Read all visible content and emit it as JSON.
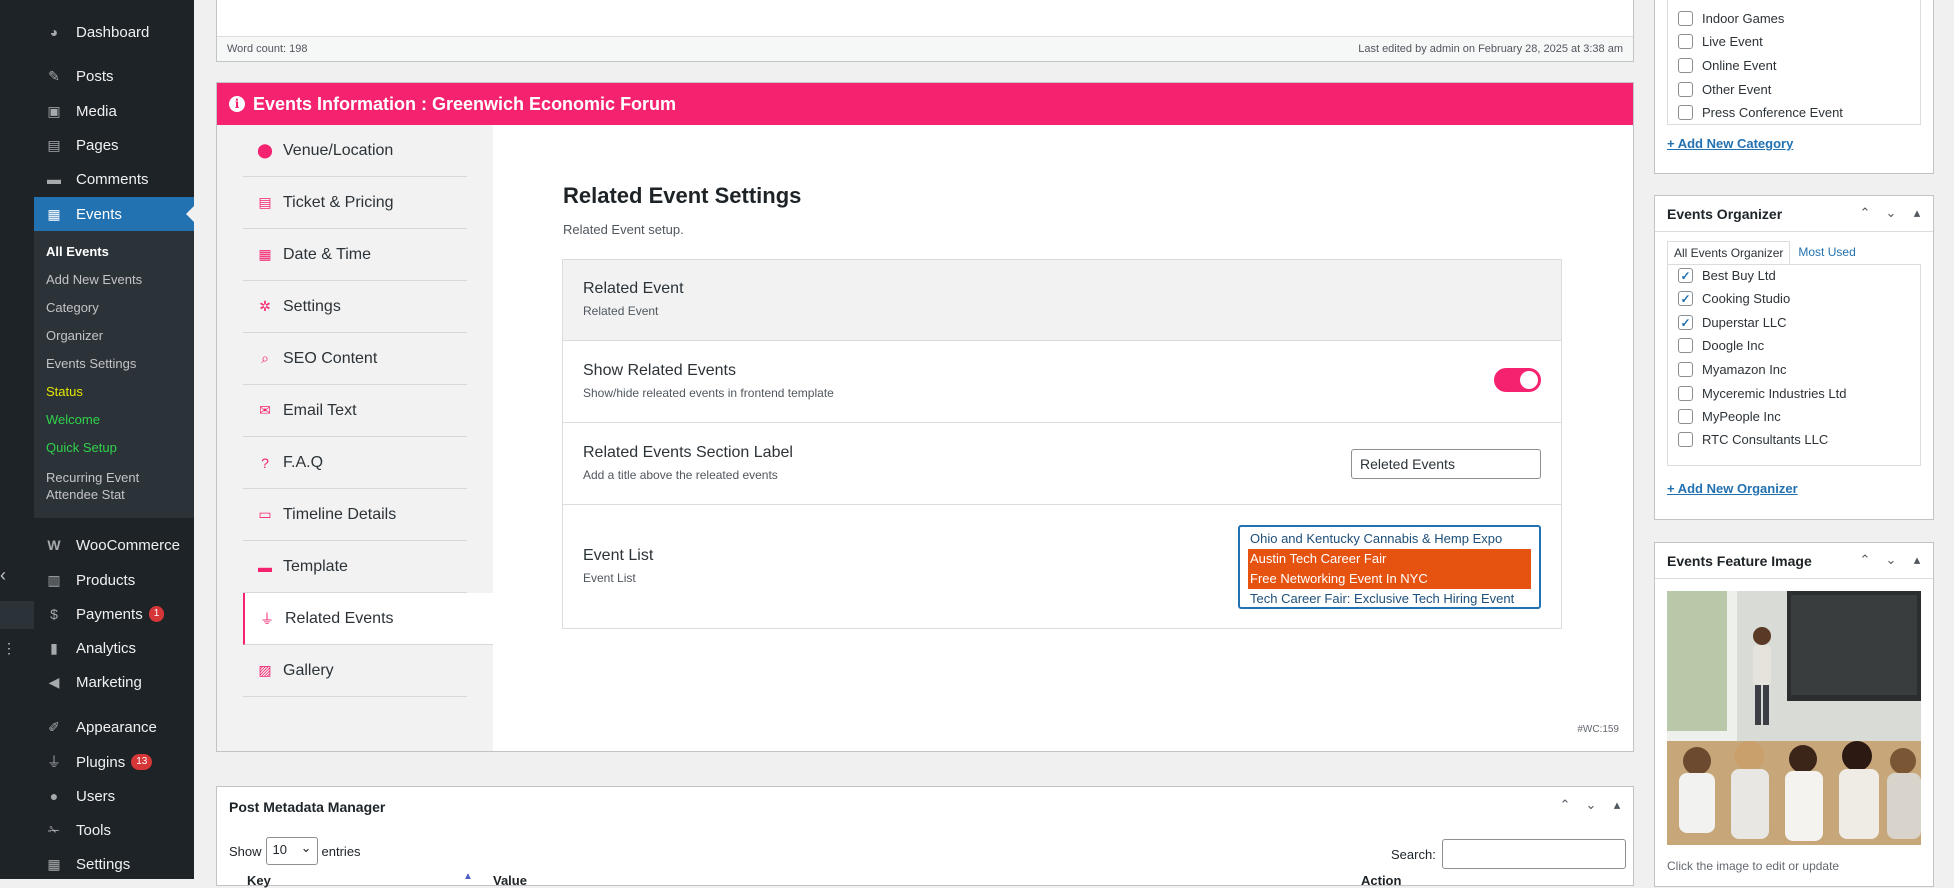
{
  "sidebar": {
    "items": [
      {
        "label": "Dashboard",
        "icon": "dashboard-icon"
      },
      {
        "label": "Posts",
        "icon": "pin-icon"
      },
      {
        "label": "Media",
        "icon": "media-icon"
      },
      {
        "label": "Pages",
        "icon": "page-icon"
      },
      {
        "label": "Comments",
        "icon": "comment-icon"
      },
      {
        "label": "Events",
        "icon": "calendar-icon"
      }
    ],
    "submenu": [
      {
        "label": "All Events"
      },
      {
        "label": "Add New Events"
      },
      {
        "label": "Category"
      },
      {
        "label": "Organizer"
      },
      {
        "label": "Events Settings"
      },
      {
        "label": "Status"
      },
      {
        "label": "Welcome"
      },
      {
        "label": "Quick Setup"
      },
      {
        "label": "Recurring Event Attendee Stat"
      }
    ],
    "lower": [
      {
        "label": "WooCommerce",
        "icon": "woo-icon"
      },
      {
        "label": "Products",
        "icon": "archive-icon"
      },
      {
        "label": "Payments",
        "icon": "dollar-icon",
        "badge": "1"
      },
      {
        "label": "Analytics",
        "icon": "chart-icon"
      },
      {
        "label": "Marketing",
        "icon": "megaphone-icon"
      },
      {
        "label": "Appearance",
        "icon": "brush-icon"
      },
      {
        "label": "Plugins",
        "icon": "plug-icon",
        "badge": "13"
      },
      {
        "label": "Users",
        "icon": "user-icon"
      },
      {
        "label": "Tools",
        "icon": "wrench-icon"
      },
      {
        "label": "Settings",
        "icon": "settings-icon"
      }
    ]
  },
  "editor": {
    "word_count": "Word count: 198",
    "last_edited": "Last edited by admin on February 28, 2025 at 3:38 am"
  },
  "events_box": {
    "title": "Events Information : Greenwich Economic Forum",
    "tabs": [
      {
        "label": "Venue/Location",
        "icon": "map-pin-icon"
      },
      {
        "label": "Ticket & Pricing",
        "icon": "ticket-icon"
      },
      {
        "label": "Date & Time",
        "icon": "calendar-icon"
      },
      {
        "label": "Settings",
        "icon": "cogs-icon"
      },
      {
        "label": "SEO Content",
        "icon": "search-icon"
      },
      {
        "label": "Email Text",
        "icon": "envelope-icon"
      },
      {
        "label": "F.A.Q",
        "icon": "question-icon"
      },
      {
        "label": "Timeline Details",
        "icon": "timeline-icon"
      },
      {
        "label": "Template",
        "icon": "template-icon"
      },
      {
        "label": "Related Events",
        "icon": "plug-icon"
      },
      {
        "label": "Gallery",
        "icon": "images-icon"
      }
    ],
    "active_tab": "Related Events",
    "panel": {
      "title": "Related Event Settings",
      "subtitle": "Related Event setup.",
      "rows": {
        "related_event": {
          "label": "Related Event",
          "desc": "Related Event"
        },
        "show_related": {
          "label": "Show Related Events",
          "desc": "Show/hide releated events in frontend template",
          "enabled": true
        },
        "section_label": {
          "label": "Related Events Section Label",
          "desc": "Add a title above the releated events",
          "value": "Releted Events"
        },
        "event_list": {
          "label": "Event List",
          "desc": "Event List",
          "options": [
            {
              "text": "Ohio and Kentucky Cannabis & Hemp Expo",
              "selected": false
            },
            {
              "text": "Austin Tech Career Fair",
              "selected": true
            },
            {
              "text": "Free Networking Event In NYC",
              "selected": true
            },
            {
              "text": "Tech Career Fair: Exclusive Tech Hiring Event",
              "selected": false
            }
          ]
        }
      }
    },
    "wc_ref": "#WC:159"
  },
  "post_meta": {
    "title": "Post Metadata Manager",
    "show_label": "Show",
    "entries_value": "10",
    "entries_label": "entries",
    "search_label": "Search:",
    "columns": [
      "Key",
      "Value",
      "Action"
    ]
  },
  "categories": {
    "items": [
      {
        "label": "Indoor Games",
        "checked": false
      },
      {
        "label": "Live Event",
        "checked": false
      },
      {
        "label": "Online Event",
        "checked": false
      },
      {
        "label": "Other Event",
        "checked": false
      },
      {
        "label": "Press Conference Event",
        "checked": false
      }
    ],
    "add_link": "+ Add New Category"
  },
  "organizer": {
    "title": "Events Organizer",
    "tab_all": "All Events Organizer",
    "tab_used": "Most Used",
    "items": [
      {
        "label": "Best Buy Ltd",
        "checked": true
      },
      {
        "label": "Cooking Studio",
        "checked": true
      },
      {
        "label": "Duperstar LLC",
        "checked": true
      },
      {
        "label": "Doogle Inc",
        "checked": false
      },
      {
        "label": "Myamazon Inc",
        "checked": false
      },
      {
        "label": "Myceremic Industries Ltd",
        "checked": false
      },
      {
        "label": "MyPeople Inc",
        "checked": false
      },
      {
        "label": "RTC Consultants LLC",
        "checked": false
      }
    ],
    "add_link": "+ Add New Organizer"
  },
  "feature_image": {
    "title": "Events Feature Image",
    "caption": "Click the image to edit or update"
  },
  "colors": {
    "accent": "#f5226f",
    "selected_option": "#e6520f",
    "admin_blue": "#2271b1",
    "sidebar_bg": "#1d2327"
  }
}
